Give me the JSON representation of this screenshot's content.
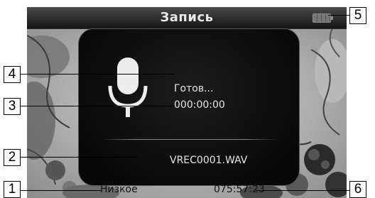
{
  "screen": {
    "title": "Запись",
    "battery_icon": "battery-icon",
    "panel": {
      "mic_icon": "microphone-icon",
      "status": "Готов...",
      "elapsed_time": "000:00:00",
      "file_name": "VREC0001.WAV"
    },
    "bottom_bar": {
      "quality": "Низкое",
      "remaining_time": "075:57:23"
    }
  },
  "callouts": {
    "c1": "1",
    "c2": "2",
    "c3": "3",
    "c4": "4",
    "c5": "5",
    "c6": "6"
  }
}
